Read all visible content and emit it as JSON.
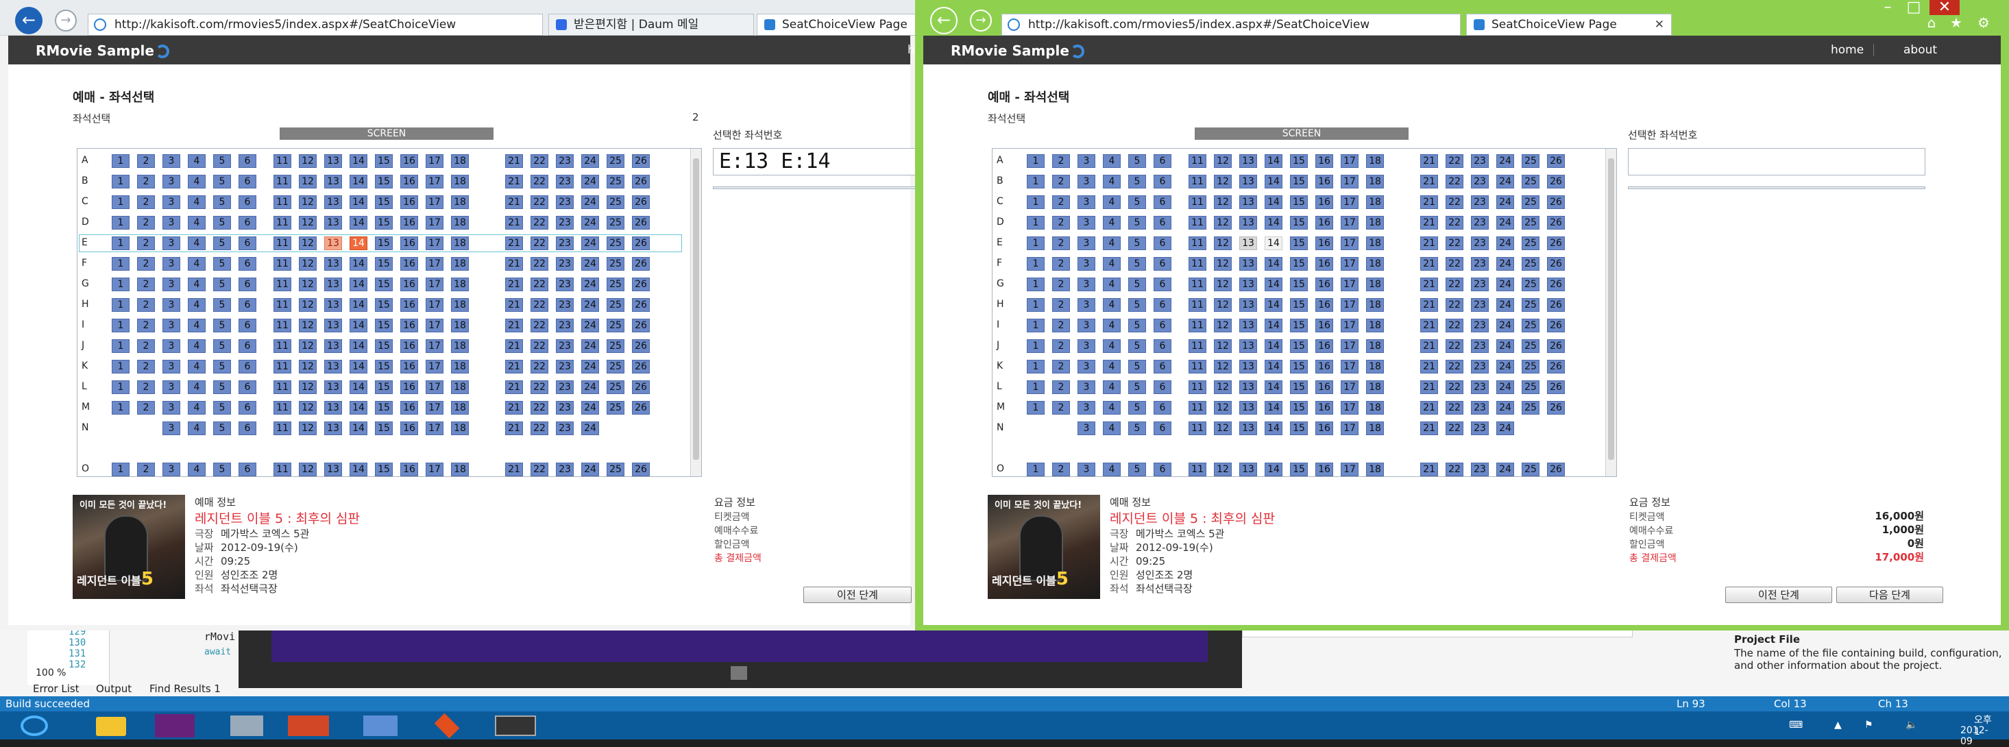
{
  "left_window": {
    "address": "http://kakisoft.com/rmovies5/index.aspx#/SeatChoiceView",
    "tabs": [
      "받은편지함 | Daum 메일",
      "SeatChoiceView Page"
    ],
    "brand": "RMovie Sample",
    "nav_partial": "h",
    "title": "예매 - 좌석선택",
    "seat_label": "좌석선택",
    "count_badge": "2",
    "screen": "SCREEN",
    "selected_label": "선택한 좌석번호",
    "selected_value": "E:13 E:14",
    "booking_info_title": "예매 정보",
    "movie_title": "레지던트 이블 5 : 최후의 심판",
    "fee_title": "요금 정보",
    "fee_labels": [
      "티켓금액",
      "예매수수료",
      "할인금액",
      "총 결제금액"
    ],
    "prev_button": "이전 단계"
  },
  "right_window": {
    "address": "http://kakisoft.com/rmovies5/index.aspx#/SeatChoiceView",
    "tab": "SeatChoiceView Page",
    "brand": "RMovie Sample",
    "nav": [
      "home",
      "about"
    ],
    "title": "예매 - 좌석선택",
    "seat_label": "좌석선택",
    "screen": "SCREEN",
    "selected_label": "선택한 좌석번호",
    "selected_value": "",
    "booking_info_title": "예매 정보",
    "movie_title": "레지던트 이블 5 : 최후의 심판",
    "fee_title": "요금 정보",
    "fee_labels": [
      "티켓금액",
      "예매수수료",
      "할인금액",
      "총 결제금액"
    ],
    "fee_values": [
      "16,000원",
      "1,000원",
      "0원",
      "17,000원"
    ],
    "prev_button": "이전 단계",
    "next_button": "다음 단계"
  },
  "booking": [
    {
      "key": "극장",
      "value": "메가박스 코엑스 5관"
    },
    {
      "key": "날짜",
      "value": "2012-09-19(수)"
    },
    {
      "key": "시간",
      "value": "09:25"
    },
    {
      "key": "인원",
      "value": "성인조조 2명"
    },
    {
      "key": "좌석",
      "value": "좌석선택극장"
    }
  ],
  "poster": {
    "top_text": "이미 모든 것이 끝났다!",
    "bottom_text": "레지던트 이블",
    "num": "5"
  },
  "rows": [
    "A",
    "B",
    "C",
    "D",
    "E",
    "F",
    "G",
    "H",
    "I",
    "J",
    "K",
    "L",
    "M",
    "N",
    "O"
  ],
  "seat_groups": [
    [
      "1",
      "2",
      "3",
      "4",
      "5",
      "6"
    ],
    [
      "11",
      "12",
      "13",
      "14",
      "15",
      "16",
      "17",
      "18"
    ],
    [
      "21",
      "22",
      "23",
      "24",
      "25",
      "26"
    ]
  ],
  "row_n_seats": [
    [
      "3",
      "4",
      "5",
      "6"
    ],
    [
      "11",
      "12",
      "13",
      "14",
      "15",
      "16",
      "17",
      "18"
    ],
    [
      "21",
      "22",
      "23",
      "24"
    ]
  ],
  "selected_seats": [
    "E:13",
    "E:14"
  ],
  "ide": {
    "line_numbers": [
      "129",
      "130",
      "131",
      "132"
    ],
    "code": [
      "rMovi",
      "await"
    ],
    "zoom": "100 %",
    "panel_tabs": [
      "Error List",
      "Output",
      "Find Results 1"
    ],
    "status": "Build succeeded",
    "ln": "Ln 93",
    "col": "Col 13",
    "ch": "Ch 13",
    "project_file_title": "Project File",
    "project_file_desc": "The name of the file containing build, configuration, and other information about the project."
  },
  "tray": {
    "time": "오후 1",
    "date": "2012-09"
  },
  "colors": {
    "seat": "#6b89c8",
    "selected": "#ef6a3c",
    "green_frame": "#8fd14f",
    "taskbar": "#0b5a9a"
  }
}
